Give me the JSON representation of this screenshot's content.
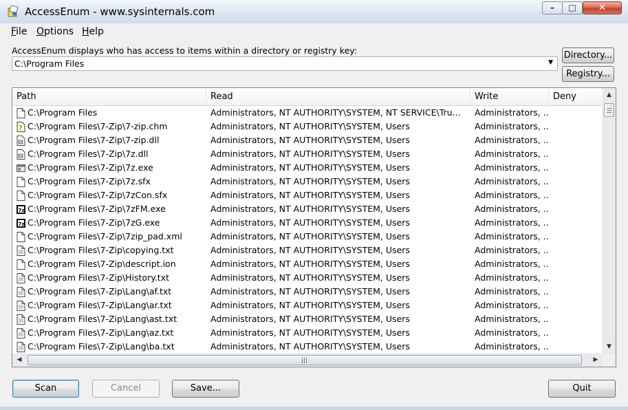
{
  "window": {
    "title": "AccessEnum - www.sysinternals.com",
    "buttons": {
      "minimize": "–",
      "maximize": "□",
      "close": "✕"
    }
  },
  "menu": [
    "File",
    "Options",
    "Help"
  ],
  "description": "AccessEnum displays who has access to items within a directory or registry key:",
  "path_input": {
    "value": "C:\\Program Files"
  },
  "side_buttons": {
    "directory": "Directory...",
    "registry": "Registry..."
  },
  "columns": [
    "Path",
    "Read",
    "Write",
    "Deny"
  ],
  "rows": [
    {
      "path": "C:\\Program Files",
      "read": "Administrators, NT AUTHORITY\\SYSTEM, NT SERVICE\\Tru...",
      "write": "Administrators, ...",
      "deny": "",
      "icon": "folder-file-icon"
    },
    {
      "path": "C:\\Program Files\\7-Zip\\7-zip.chm",
      "read": "Administrators, NT AUTHORITY\\SYSTEM, Users",
      "write": "Administrators, ...",
      "deny": "",
      "icon": "help-file-icon"
    },
    {
      "path": "C:\\Program Files\\7-Zip\\7-zip.dll",
      "read": "Administrators, NT AUTHORITY\\SYSTEM, Users",
      "write": "Administrators, ...",
      "deny": "",
      "icon": "dll-file-icon"
    },
    {
      "path": "C:\\Program Files\\7-Zip\\7z.dll",
      "read": "Administrators, NT AUTHORITY\\SYSTEM, Users",
      "write": "Administrators, ...",
      "deny": "",
      "icon": "dll-file-icon"
    },
    {
      "path": "C:\\Program Files\\7-Zip\\7z.exe",
      "read": "Administrators, NT AUTHORITY\\SYSTEM, Users",
      "write": "Administrators, ...",
      "deny": "",
      "icon": "exe-file-icon"
    },
    {
      "path": "C:\\Program Files\\7-Zip\\7z.sfx",
      "read": "Administrators, NT AUTHORITY\\SYSTEM, Users",
      "write": "Administrators, ...",
      "deny": "",
      "icon": "file-icon"
    },
    {
      "path": "C:\\Program Files\\7-Zip\\7zCon.sfx",
      "read": "Administrators, NT AUTHORITY\\SYSTEM, Users",
      "write": "Administrators, ...",
      "deny": "",
      "icon": "file-icon"
    },
    {
      "path": "C:\\Program Files\\7-Zip\\7zFM.exe",
      "read": "Administrators, NT AUTHORITY\\SYSTEM, Users",
      "write": "Administrators, ...",
      "deny": "",
      "icon": "7zip-app-icon"
    },
    {
      "path": "C:\\Program Files\\7-Zip\\7zG.exe",
      "read": "Administrators, NT AUTHORITY\\SYSTEM, Users",
      "write": "Administrators, ...",
      "deny": "",
      "icon": "7zip-app-icon"
    },
    {
      "path": "C:\\Program Files\\7-Zip\\7zip_pad.xml",
      "read": "Administrators, NT AUTHORITY\\SYSTEM, Users",
      "write": "Administrators, ...",
      "deny": "",
      "icon": "file-icon"
    },
    {
      "path": "C:\\Program Files\\7-Zip\\copying.txt",
      "read": "Administrators, NT AUTHORITY\\SYSTEM, Users",
      "write": "Administrators, ...",
      "deny": "",
      "icon": "text-file-icon"
    },
    {
      "path": "C:\\Program Files\\7-Zip\\descript.ion",
      "read": "Administrators, NT AUTHORITY\\SYSTEM, Users",
      "write": "Administrators, ...",
      "deny": "",
      "icon": "file-icon"
    },
    {
      "path": "C:\\Program Files\\7-Zip\\History.txt",
      "read": "Administrators, NT AUTHORITY\\SYSTEM, Users",
      "write": "Administrators, ...",
      "deny": "",
      "icon": "text-file-icon"
    },
    {
      "path": "C:\\Program Files\\7-Zip\\Lang\\af.txt",
      "read": "Administrators, NT AUTHORITY\\SYSTEM, Users",
      "write": "Administrators, ...",
      "deny": "",
      "icon": "text-file-icon"
    },
    {
      "path": "C:\\Program Files\\7-Zip\\Lang\\ar.txt",
      "read": "Administrators, NT AUTHORITY\\SYSTEM, Users",
      "write": "Administrators, ...",
      "deny": "",
      "icon": "text-file-icon"
    },
    {
      "path": "C:\\Program Files\\7-Zip\\Lang\\ast.txt",
      "read": "Administrators, NT AUTHORITY\\SYSTEM, Users",
      "write": "Administrators, ...",
      "deny": "",
      "icon": "text-file-icon"
    },
    {
      "path": "C:\\Program Files\\7-Zip\\Lang\\az.txt",
      "read": "Administrators, NT AUTHORITY\\SYSTEM, Users",
      "write": "Administrators, ...",
      "deny": "",
      "icon": "text-file-icon"
    },
    {
      "path": "C:\\Program Files\\7-Zip\\Lang\\ba.txt",
      "read": "Administrators, NT AUTHORITY\\SYSTEM, Users",
      "write": "Administrators, ...",
      "deny": "",
      "icon": "text-file-icon"
    }
  ],
  "bottom_buttons": {
    "scan": "Scan",
    "cancel": "Cancel",
    "save": "Save...",
    "quit": "Quit"
  },
  "colors": {
    "accent": "#3c7fb1",
    "close_button": "#c2422a",
    "title_bar": "#dfe8f3"
  }
}
